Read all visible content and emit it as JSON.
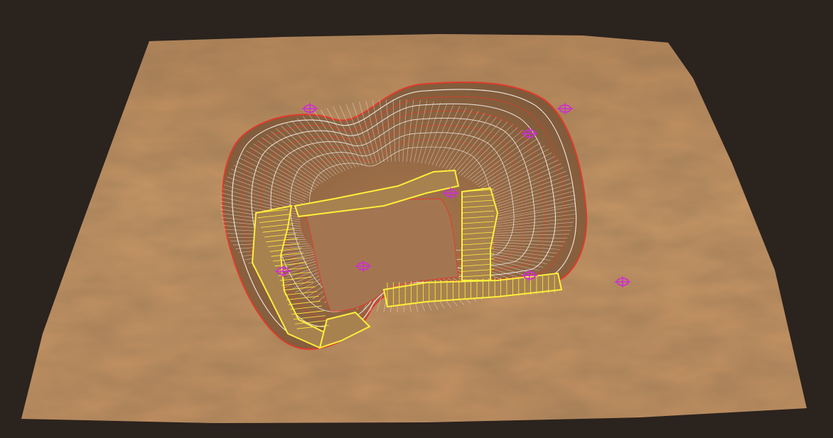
{
  "viewport": {
    "background_color": "#2b231e"
  },
  "terrain": {
    "surface_color": "#c69564",
    "shadow_color": "#8a6140",
    "highlight_color": "#d9aa78",
    "pit_floor_color": "#9c6f4a"
  },
  "pit": {
    "crest_line_color": "#e23a2a",
    "bench_line_color": "#ffffff",
    "ramp_color": "#ffef3a",
    "ramp_fill_color": "#a7824f"
  },
  "markers": {
    "icon": "crosshair-marker-icon",
    "color": "#d02bd8",
    "count": 8
  }
}
